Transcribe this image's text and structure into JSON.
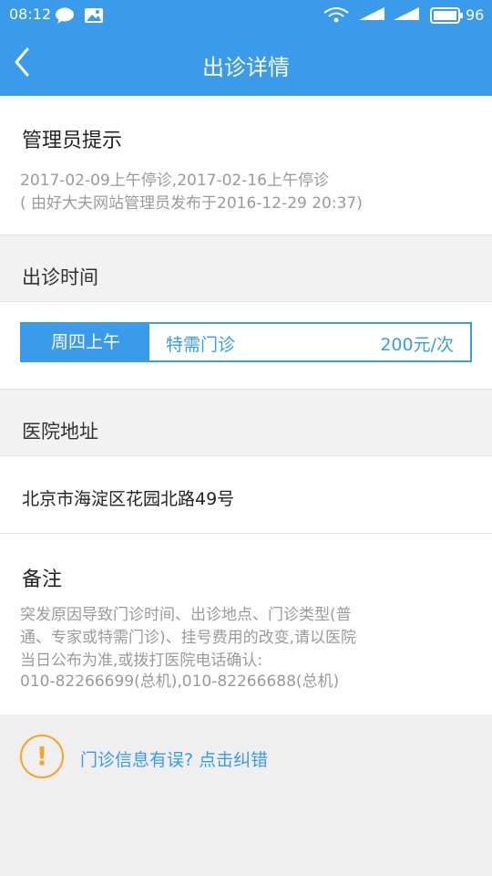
{
  "status_bar": {
    "time": "08:12",
    "battery": "96"
  },
  "app_bar": {
    "title": "出诊详情"
  },
  "admin_notice": {
    "heading": "管理员提示",
    "line1": "2017-02-09上午停诊,2017-02-16上午停诊",
    "line2": "( 由好大夫网站管理员发布于2016-12-29 20:37)"
  },
  "schedule": {
    "heading": "出诊时间",
    "day": "周四上午",
    "type": "特需门诊",
    "fee": "200元/次"
  },
  "hospital": {
    "heading": "医院地址",
    "address": "北京市海淀区花园北路49号"
  },
  "remarks": {
    "heading": "备注",
    "lines": [
      "突发原因导致门诊时间、出诊地点、门诊类型(普",
      "通、专家或特需门诊)、挂号费用的改变,请以医院",
      "当日公布为准,或拨打医院电话确认:",
      "010-82266699(总机),010-82266688(总机)"
    ]
  },
  "report": {
    "link": "门诊信息有误? 点击纠错",
    "icon": "!"
  },
  "colors": {
    "primary": "#3a9bea",
    "warning": "#f5a623"
  }
}
